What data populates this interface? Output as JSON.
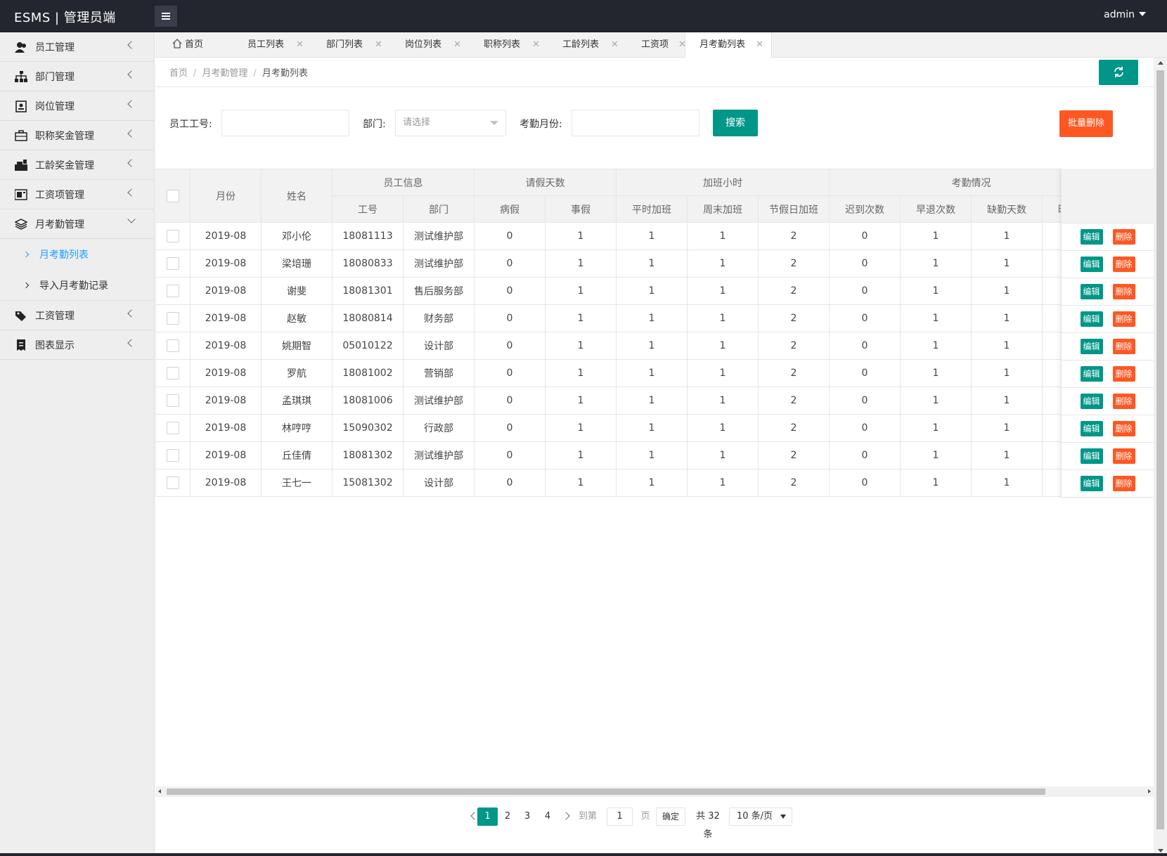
{
  "app": {
    "title": "ESMS | 管理员端",
    "user": "admin"
  },
  "sidebar": {
    "items": [
      {
        "label": "员工管理"
      },
      {
        "label": "部门管理"
      },
      {
        "label": "岗位管理"
      },
      {
        "label": "职称奖金管理"
      },
      {
        "label": "工龄奖金管理"
      },
      {
        "label": "工资项管理"
      },
      {
        "label": "月考勤管理"
      },
      {
        "label": "工资管理"
      },
      {
        "label": "图表显示"
      }
    ],
    "subitems": [
      {
        "label": "月考勤列表",
        "active": true
      },
      {
        "label": "导入月考勤记录",
        "active": false
      }
    ]
  },
  "tabs": [
    {
      "label": "首页"
    },
    {
      "label": "员工列表"
    },
    {
      "label": "部门列表"
    },
    {
      "label": "岗位列表"
    },
    {
      "label": "职称列表"
    },
    {
      "label": "工龄列表"
    },
    {
      "label": "工资项"
    },
    {
      "label": "月考勤列表"
    }
  ],
  "breadcrumb": [
    "首页",
    "月考勤管理",
    "月考勤列表"
  ],
  "search": {
    "emp_label": "员工工号:",
    "dept_label": "部门:",
    "dept_placeholder": "请选择",
    "month_label": "考勤月份:",
    "search_button": "搜索",
    "batch_delete_button": "批量删除"
  },
  "table": {
    "group_headers": [
      "员工信息",
      "请假天数",
      "加班小时",
      "考勤情况"
    ],
    "month_header": "月份",
    "name_header": "姓名",
    "sub_headers": [
      "工号",
      "部门",
      "病假",
      "事假",
      "平时加班",
      "周末加班",
      "节假日加班",
      "迟到次数",
      "早退次数",
      "缺勤天数",
      "旷工天数"
    ],
    "rows": [
      [
        "2019-08",
        "邓小伦",
        "18081113",
        "测试维护部",
        "0",
        "1",
        "1",
        "1",
        "2",
        "0",
        "1",
        "1"
      ],
      [
        "2019-08",
        "梁培珊",
        "18080833",
        "测试维护部",
        "0",
        "1",
        "1",
        "1",
        "2",
        "0",
        "1",
        "1"
      ],
      [
        "2019-08",
        "谢斐",
        "18081301",
        "售后服务部",
        "0",
        "1",
        "1",
        "1",
        "2",
        "0",
        "1",
        "1"
      ],
      [
        "2019-08",
        "赵敏",
        "18080814",
        "财务部",
        "0",
        "1",
        "1",
        "1",
        "2",
        "0",
        "1",
        "1"
      ],
      [
        "2019-08",
        "姚期智",
        "05010122",
        "设计部",
        "0",
        "1",
        "1",
        "1",
        "2",
        "0",
        "1",
        "1"
      ],
      [
        "2019-08",
        "罗航",
        "18081002",
        "营销部",
        "0",
        "1",
        "1",
        "1",
        "2",
        "0",
        "1",
        "1"
      ],
      [
        "2019-08",
        "孟琪琪",
        "18081006",
        "测试维护部",
        "0",
        "1",
        "1",
        "1",
        "2",
        "0",
        "1",
        "1"
      ],
      [
        "2019-08",
        "林哼哼",
        "15090302",
        "行政部",
        "0",
        "1",
        "1",
        "1",
        "2",
        "0",
        "1",
        "1"
      ],
      [
        "2019-08",
        "丘佳倩",
        "18081302",
        "测试维护部",
        "0",
        "1",
        "1",
        "1",
        "2",
        "0",
        "1",
        "1"
      ],
      [
        "2019-08",
        "王七一",
        "15081302",
        "设计部",
        "0",
        "1",
        "1",
        "1",
        "2",
        "0",
        "1",
        "1"
      ]
    ],
    "edit_label": "编辑",
    "delete_label": "删除"
  },
  "pagination": {
    "pages": [
      "1",
      "2",
      "3",
      "4"
    ],
    "current": "1",
    "goto_label": "到第",
    "goto_value": "1",
    "page_unit": "页",
    "confirm": "确定",
    "total": "共 32 条",
    "page_size": "10 条/页"
  },
  "colors": {
    "accent": "#009688",
    "danger": "#ff5722",
    "link": "#1e9fff",
    "topbar": "#23262e"
  }
}
